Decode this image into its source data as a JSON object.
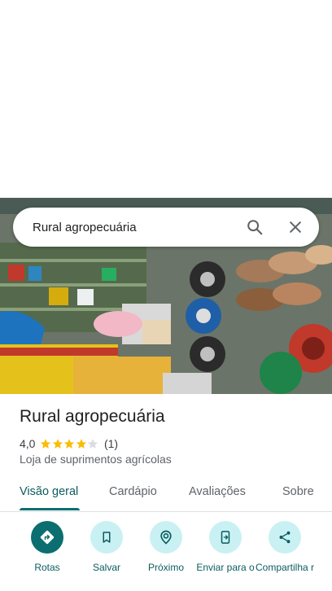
{
  "search": {
    "query": "Rural agropecuária"
  },
  "place": {
    "name": "Rural agropecuária",
    "rating": "4,0",
    "rating_value": 4,
    "reviews": "(1)",
    "category": "Loja de suprimentos agrícolas"
  },
  "tabs": [
    {
      "label": "Visão geral",
      "active": true
    },
    {
      "label": "Cardápio"
    },
    {
      "label": "Avaliações"
    },
    {
      "label": "Sobre"
    }
  ],
  "actions": [
    {
      "label": "Rotas",
      "icon": "directions-icon"
    },
    {
      "label": "Salvar",
      "icon": "bookmark-icon"
    },
    {
      "label": "Próximo",
      "icon": "nearby-icon"
    },
    {
      "label": "Enviar para o",
      "icon": "send-to-phone-icon"
    },
    {
      "label": "Compartilha r",
      "icon": "share-icon"
    }
  ],
  "colors": {
    "accent": "#0b6e70",
    "star": "#fbbc04",
    "action_bg": "#c9f1f3"
  }
}
